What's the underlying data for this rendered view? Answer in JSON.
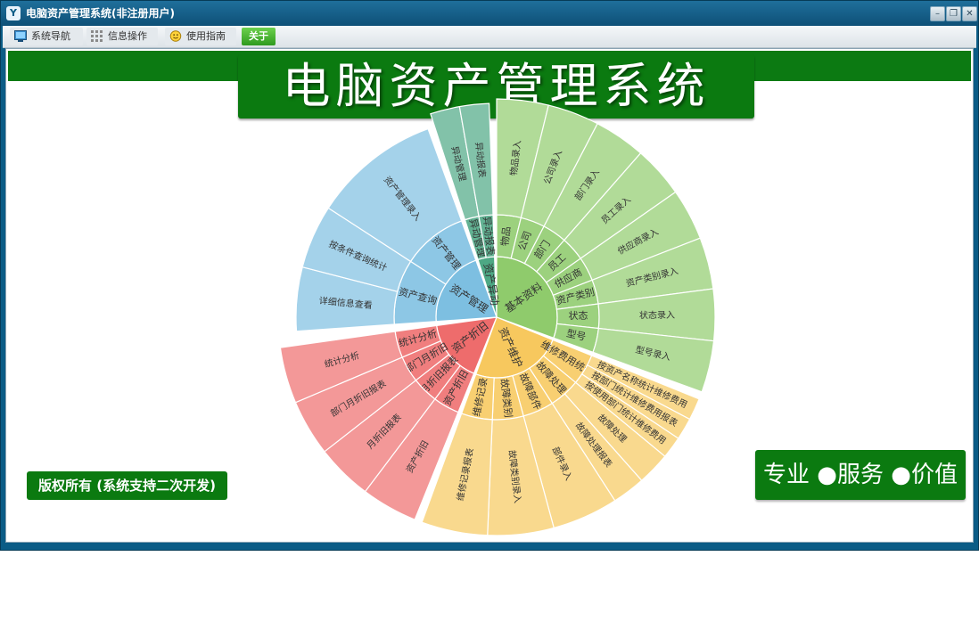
{
  "window": {
    "title": "电脑资产管理系统(非注册用户)",
    "app_icon": "Y",
    "controls": {
      "minimize": "–",
      "restore": "❐",
      "close": "✕"
    }
  },
  "toolbar": {
    "items": [
      {
        "label": "系统导航",
        "icon": "monitor-icon"
      },
      {
        "label": "信息操作",
        "icon": "grid-icon"
      },
      {
        "label": "使用指南",
        "icon": "smiley-icon"
      },
      {
        "label": "关于",
        "icon": ""
      }
    ]
  },
  "banner": {
    "title": "电脑资产管理系统"
  },
  "footer": {
    "copyright": "版权所有 (系统支持二次开发)",
    "slogan": "专业 ●服务 ●价值"
  },
  "colors": {
    "basic": "#8fcb6c",
    "maintenance": "#f7c85e",
    "depreciation": "#ee6c6c",
    "management": "#7dbfe1",
    "change": "#4da884",
    "title_green": "#0b7a10"
  },
  "sunburst": {
    "groups": [
      {
        "name": "基本资料",
        "color": "#8fcb6c",
        "children": [
          {
            "name": "物品",
            "leaf": "物品录入"
          },
          {
            "name": "公司",
            "leaf": "公司录入"
          },
          {
            "name": "部门",
            "leaf": "部门录入"
          },
          {
            "name": "员工",
            "leaf": "员工录入"
          },
          {
            "name": "供应商",
            "leaf": "供应商录入"
          },
          {
            "name": "资产类别",
            "leaf": "资产类别录入"
          },
          {
            "name": "状态",
            "leaf": "状态录入"
          },
          {
            "name": "型号",
            "leaf": "型号录入"
          }
        ]
      },
      {
        "name": "资产维护",
        "color": "#f7c85e",
        "children": [
          {
            "name": "维修费用统计",
            "leaves": [
              "按资产名称统计维修费用",
              "按部门统计维修费用报表",
              "按使用部门统计维修费用"
            ]
          },
          {
            "name": "故障处理",
            "leaves": [
              "故障处理",
              "故障处理报表"
            ]
          },
          {
            "name": "故障部件",
            "leaves": [
              "部件录入"
            ]
          },
          {
            "name": "故障类别",
            "leaves": [
              "故障类别录入"
            ]
          },
          {
            "name": "维修记录",
            "leaves": [
              "维修记录报表"
            ]
          }
        ]
      },
      {
        "name": "资产折旧",
        "color": "#ee6c6c",
        "children": [
          {
            "name": "资产折旧",
            "leaves": [
              "资产折旧"
            ]
          },
          {
            "name": "月折旧报表",
            "leaves": [
              "月折旧报表"
            ]
          },
          {
            "name": "部门月折旧",
            "leaves": [
              "部门月折旧报表"
            ]
          },
          {
            "name": "统计分析",
            "leaves": [
              "统计分析"
            ]
          }
        ]
      },
      {
        "name": "资产管理",
        "color": "#7dbfe1",
        "children": [
          {
            "name": "资产查询",
            "leaves": [
              "详细信息查看",
              "按条件查询统计"
            ]
          },
          {
            "name": "资产管理",
            "leaves": [
              "资产管理录入"
            ]
          }
        ]
      },
      {
        "name": "资产异动",
        "color": "#4da884",
        "children": [
          {
            "name": "异动管理",
            "leaves": [
              "异动管理"
            ]
          },
          {
            "name": "异动报表",
            "leaves": [
              "异动报表"
            ]
          }
        ]
      }
    ]
  }
}
